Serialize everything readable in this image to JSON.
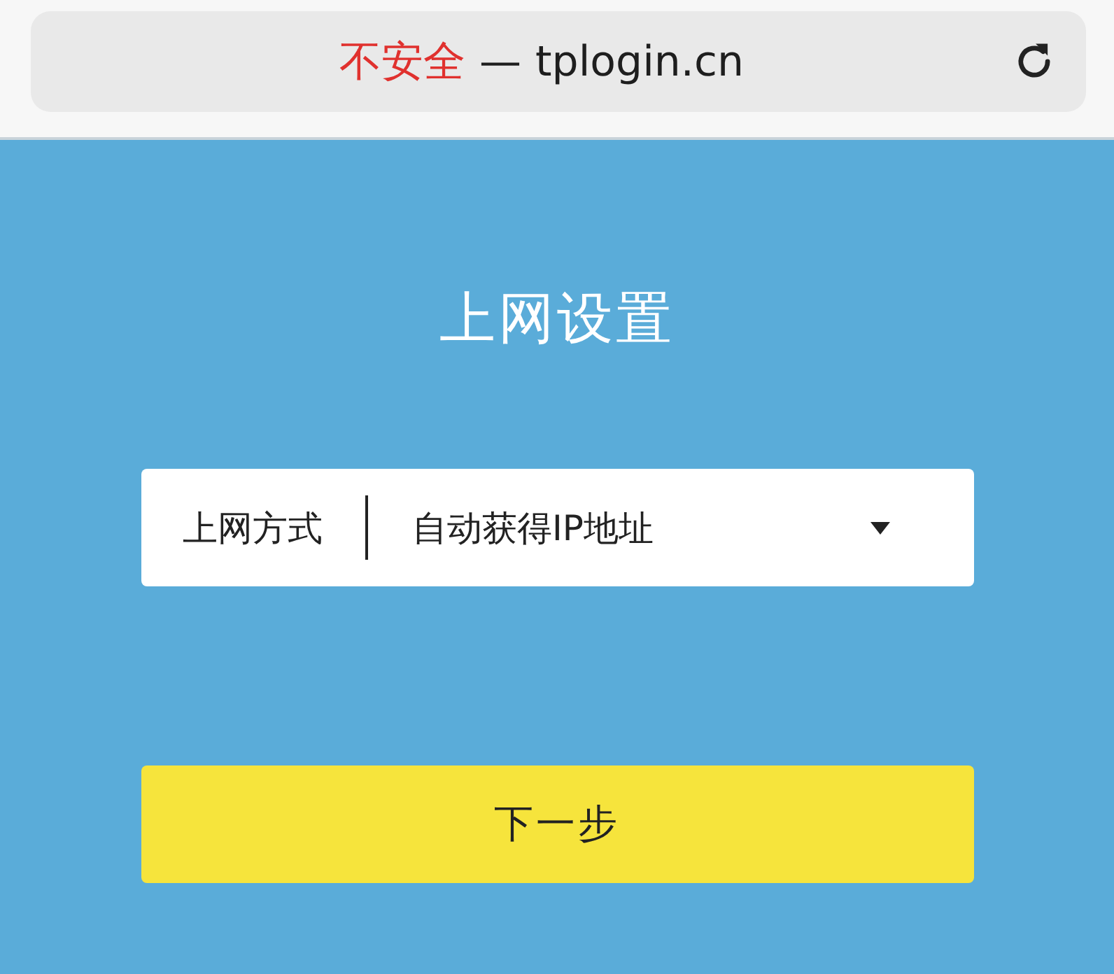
{
  "address_bar": {
    "security_label": "不安全",
    "separator": "—",
    "url": "tplogin.cn"
  },
  "title": "上网设置",
  "field": {
    "label": "上网方式",
    "value": "自动获得IP地址"
  },
  "button": {
    "label": "下一步"
  }
}
